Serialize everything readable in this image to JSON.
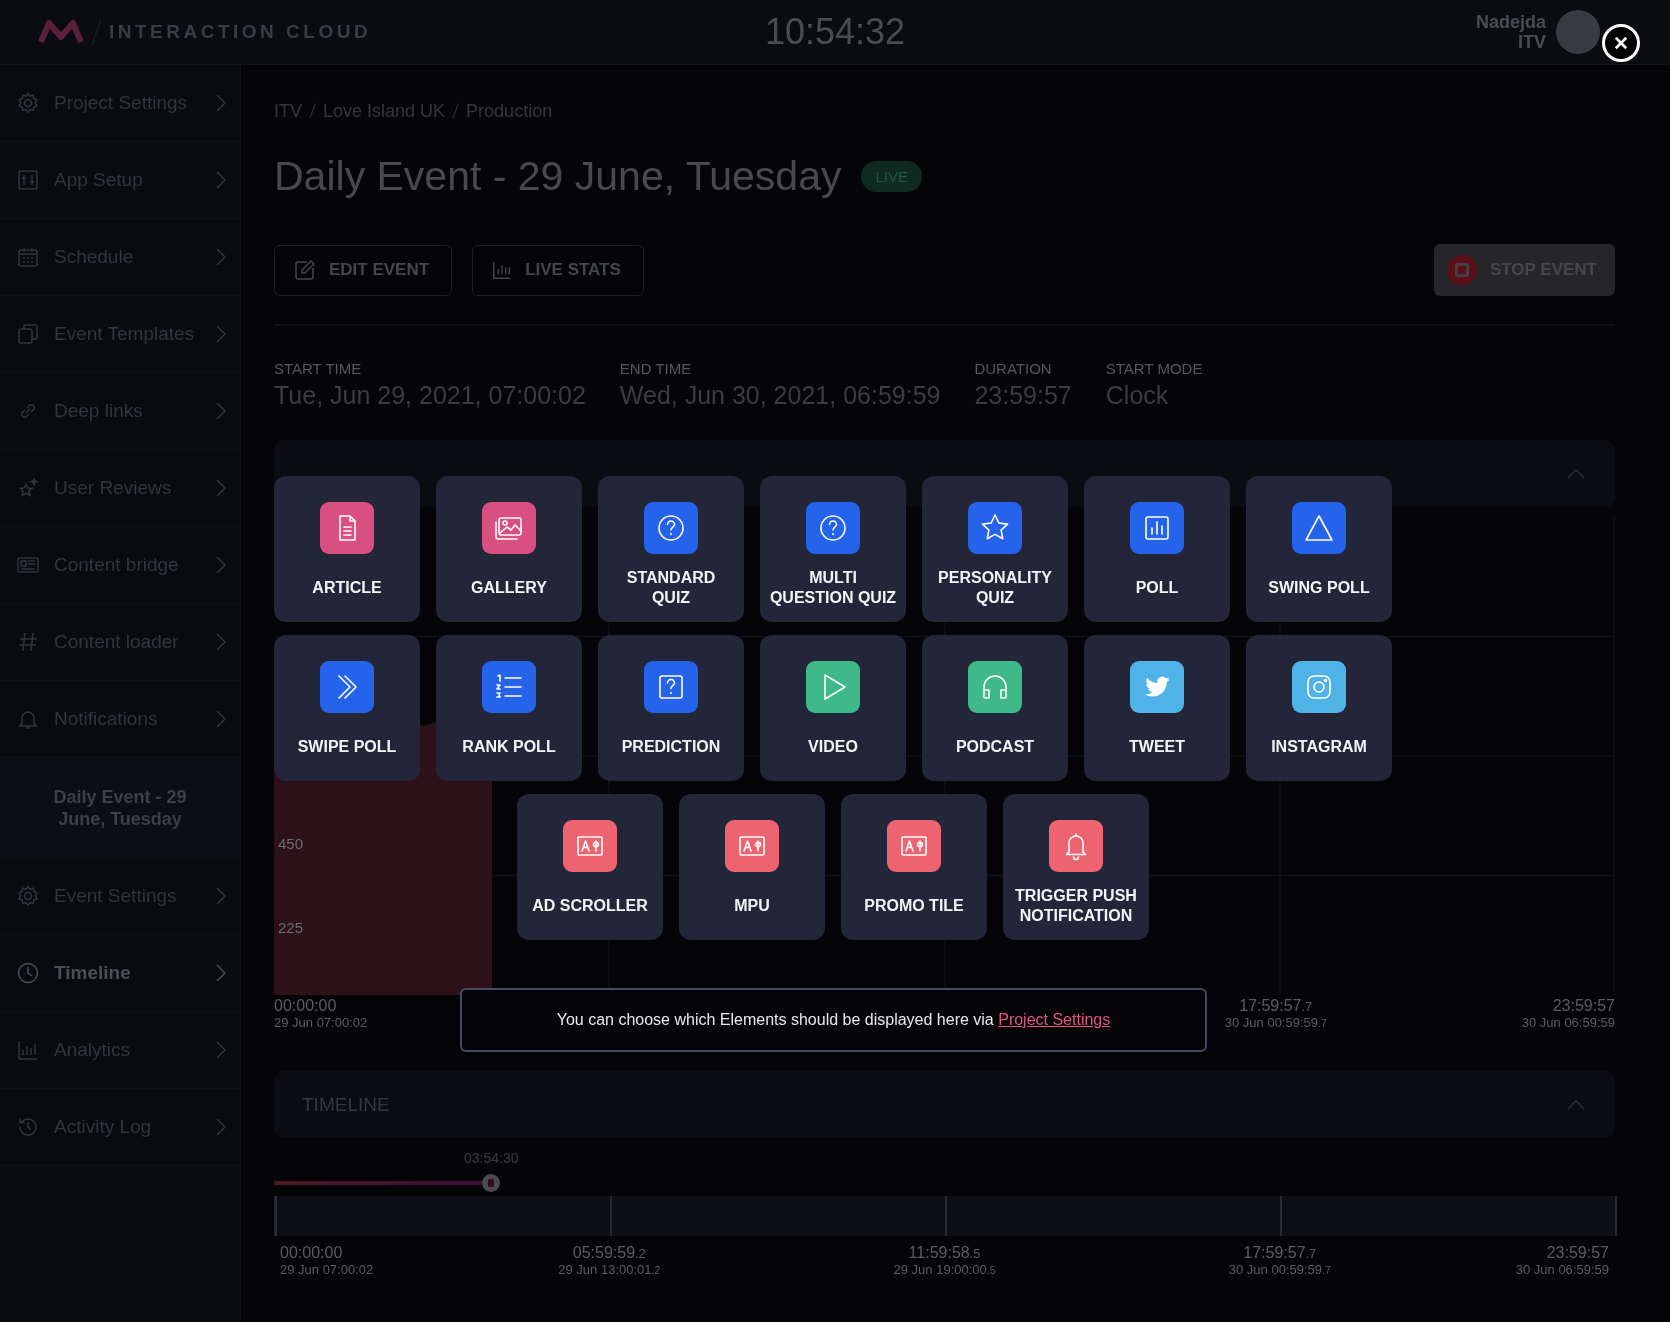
{
  "header": {
    "app_name": "INTERACTION CLOUD",
    "clock": "10:54:32",
    "user": {
      "name": "Nadejda",
      "org": "ITV"
    }
  },
  "sidebar": {
    "project_items": [
      {
        "label": "Project Settings",
        "kind": "gear",
        "selected": false
      },
      {
        "label": "App Setup",
        "kind": "sliders",
        "selected": false
      },
      {
        "label": "Schedule",
        "kind": "calendar",
        "selected": false
      },
      {
        "label": "Event Templates",
        "kind": "copies",
        "selected": false
      },
      {
        "label": "Deep links",
        "kind": "link",
        "selected": false
      },
      {
        "label": "User Reviews",
        "kind": "stars",
        "selected": false
      },
      {
        "label": "Content bridge",
        "kind": "newspaper",
        "selected": false
      },
      {
        "label": "Content loader",
        "kind": "hash",
        "selected": false
      },
      {
        "label": "Notifications",
        "kind": "bell",
        "selected": false
      }
    ],
    "event": {
      "title": "Daily Event - 29 June, Tuesday"
    },
    "event_items": [
      {
        "label": "Event Settings",
        "kind": "gear",
        "selected": false
      },
      {
        "label": "Timeline",
        "kind": "clock",
        "selected": true
      },
      {
        "label": "Analytics",
        "kind": "bars",
        "selected": false
      },
      {
        "label": "Activity Log",
        "kind": "history",
        "selected": false
      }
    ]
  },
  "breadcrumb": [
    "ITV",
    "Love Island UK",
    "Production"
  ],
  "title": "Daily Event - 29 June, Tuesday",
  "status_badge": "LIVE",
  "actions": [
    {
      "label": "EDIT EVENT",
      "kind": "edit"
    },
    {
      "label": "LIVE STATS",
      "kind": "stats"
    }
  ],
  "stop_button": "STOP EVENT",
  "stats": [
    {
      "label": "START TIME",
      "value": "Tue, Jun 29, 2021, 07:00:02"
    },
    {
      "label": "END TIME",
      "value": "Wed, Jun 30, 2021, 06:59:59"
    },
    {
      "label": "DURATION",
      "value": "23:59:57"
    },
    {
      "label": "START MODE",
      "value": "Clock"
    }
  ],
  "live_activity": {
    "y_labels": [
      "450",
      "225"
    ],
    "x_labels": [
      {
        "time": "00:00:00",
        "date": "29 Jun 07:00:02"
      },
      {
        "time": "17:59:57",
        "fraction": ".7",
        "date": "30 Jun 00:59:59",
        "date_fraction": ".7"
      },
      {
        "time": "23:59:57",
        "date": "30 Jun 06:59:59"
      }
    ]
  },
  "timeline": {
    "title": "TIMELINE",
    "marker": "03:54:30",
    "level": 0.162,
    "labels": [
      {
        "time": "00:00:00",
        "date": "29 Jun 07:00:02"
      },
      {
        "time": "05:59:59",
        "fraction": ".2",
        "date": "29 Jun 13:00:01",
        "date_fraction": ".2"
      },
      {
        "time": "11:59:58",
        "fraction": ".5",
        "date": "29 Jun 19:00:00",
        "date_fraction": ".5"
      },
      {
        "time": "17:59:57",
        "fraction": ".7",
        "date": "30 Jun 00:59:59",
        "date_fraction": ".7"
      },
      {
        "time": "23:59:57",
        "date": "30 Jun 06:59:59"
      }
    ]
  },
  "element_picker": {
    "tiles": [
      {
        "label": "ARTICLE",
        "kind": "article",
        "color": "#d94f7f"
      },
      {
        "label": "GALLERY",
        "kind": "gallery",
        "color": "#d94f7f"
      },
      {
        "label": "STANDARD QUIZ",
        "kind": "quiz",
        "color": "#2563eb"
      },
      {
        "label": "MULTI QUESTION QUIZ",
        "kind": "quiz",
        "color": "#2563eb"
      },
      {
        "label": "PERSONALITY QUIZ",
        "kind": "star",
        "color": "#2563eb"
      },
      {
        "label": "POLL",
        "kind": "poll",
        "color": "#2563eb"
      },
      {
        "label": "SWING POLL",
        "kind": "triangle",
        "color": "#2563eb"
      },
      {
        "label": "SWIPE POLL",
        "kind": "swipe",
        "color": "#2563eb"
      },
      {
        "label": "RANK POLL",
        "kind": "rank",
        "color": "#2563eb"
      },
      {
        "label": "PREDICTION",
        "kind": "prediction",
        "color": "#2563eb"
      },
      {
        "label": "VIDEO",
        "kind": "video",
        "color": "#3fb98a"
      },
      {
        "label": "PODCAST",
        "kind": "podcast",
        "color": "#3fb98a"
      },
      {
        "label": "TWEET",
        "kind": "bird",
        "color": "#4fb3e8"
      },
      {
        "label": "INSTAGRAM",
        "kind": "camera",
        "color": "#4fb3e8"
      },
      {
        "label": "AD SCROLLER",
        "kind": "ad",
        "color": "#ee6370"
      },
      {
        "label": "MPU",
        "kind": "ad",
        "color": "#ee6370"
      },
      {
        "label": "PROMO TILE",
        "kind": "ad",
        "color": "#ee6370"
      },
      {
        "label": "TRIGGER PUSH NOTIFICATION",
        "kind": "bell",
        "color": "#ee6370"
      }
    ],
    "hint": "You can choose which Elements should be displayed here via",
    "hint_link": "Project Settings"
  }
}
